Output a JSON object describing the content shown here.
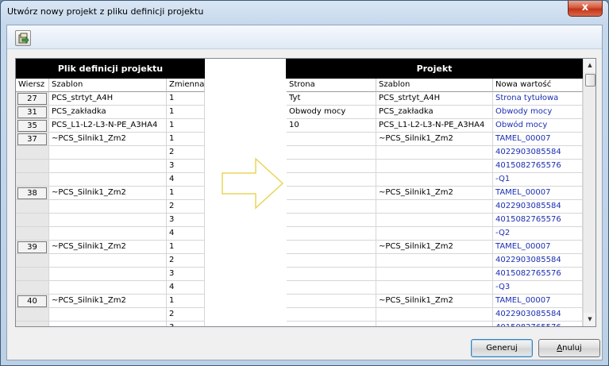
{
  "window": {
    "title": "Utwórz nowy projekt z pliku definicji projektu",
    "close_glyph": "x"
  },
  "toolbar": {
    "tool_icon": "export-icon"
  },
  "left_panel": {
    "title": "Plik definicji projektu",
    "columns": [
      "Wiersz",
      "Szablon",
      "Zmienna"
    ]
  },
  "right_panel": {
    "title": "Projekt",
    "columns": [
      "Strona",
      "Szablon",
      "Nowa wartość"
    ]
  },
  "rows": [
    {
      "wiersz": "27",
      "szablon": "PCS_strtyt_A4H",
      "zmienna": "1",
      "strona": "Tyt",
      "szablon2": "PCS_strtyt_A4H",
      "nowa": "Strona tytułowa"
    },
    {
      "wiersz": "31",
      "szablon": "PCS_zakładka",
      "zmienna": "1",
      "strona": "Obwody mocy",
      "szablon2": "PCS_zakładka",
      "nowa": "Obwody mocy"
    },
    {
      "wiersz": "35",
      "szablon": "PCS_L1-L2-L3-N-PE_A3HA4",
      "zmienna": "1",
      "strona": "10",
      "szablon2": "PCS_L1-L2-L3-N-PE_A3HA4",
      "nowa": "Obwód mocy"
    },
    {
      "wiersz": "37",
      "szablon": "~PCS_Silnik1_Zm2",
      "zmienna": "1",
      "strona": "",
      "szablon2": "~PCS_Silnik1_Zm2",
      "nowa": "TAMEL_00007"
    },
    {
      "wiersz": "",
      "szablon": "",
      "zmienna": "2",
      "strona": "",
      "szablon2": "",
      "nowa": "4022903085584"
    },
    {
      "wiersz": "",
      "szablon": "",
      "zmienna": "3",
      "strona": "",
      "szablon2": "",
      "nowa": "4015082765576"
    },
    {
      "wiersz": "",
      "szablon": "",
      "zmienna": "4",
      "strona": "",
      "szablon2": "",
      "nowa": "-Q1"
    },
    {
      "wiersz": "38",
      "szablon": "~PCS_Silnik1_Zm2",
      "zmienna": "1",
      "strona": "",
      "szablon2": "~PCS_Silnik1_Zm2",
      "nowa": "TAMEL_00007"
    },
    {
      "wiersz": "",
      "szablon": "",
      "zmienna": "2",
      "strona": "",
      "szablon2": "",
      "nowa": "4022903085584"
    },
    {
      "wiersz": "",
      "szablon": "",
      "zmienna": "3",
      "strona": "",
      "szablon2": "",
      "nowa": "4015082765576"
    },
    {
      "wiersz": "",
      "szablon": "",
      "zmienna": "4",
      "strona": "",
      "szablon2": "",
      "nowa": "-Q2"
    },
    {
      "wiersz": "39",
      "szablon": "~PCS_Silnik1_Zm2",
      "zmienna": "1",
      "strona": "",
      "szablon2": "~PCS_Silnik1_Zm2",
      "nowa": "TAMEL_00007"
    },
    {
      "wiersz": "",
      "szablon": "",
      "zmienna": "2",
      "strona": "",
      "szablon2": "",
      "nowa": "4022903085584"
    },
    {
      "wiersz": "",
      "szablon": "",
      "zmienna": "3",
      "strona": "",
      "szablon2": "",
      "nowa": "4015082765576"
    },
    {
      "wiersz": "",
      "szablon": "",
      "zmienna": "4",
      "strona": "",
      "szablon2": "",
      "nowa": "-Q3"
    },
    {
      "wiersz": "40",
      "szablon": "~PCS_Silnik1_Zm2",
      "zmienna": "1",
      "strona": "",
      "szablon2": "~PCS_Silnik1_Zm2",
      "nowa": "TAMEL_00007"
    },
    {
      "wiersz": "",
      "szablon": "",
      "zmienna": "2",
      "strona": "",
      "szablon2": "",
      "nowa": "4022903085584"
    },
    {
      "wiersz": "",
      "szablon": "",
      "zmienna": "3",
      "strona": "",
      "szablon2": "",
      "nowa": "4015082765576"
    }
  ],
  "scrollbar": {
    "up_glyph": "▲",
    "down_glyph": "▼"
  },
  "buttons": {
    "generate": "Generuj",
    "cancel_underlined": "A",
    "cancel_rest": "nuluj"
  },
  "colors": {
    "value_text": "#1b2fb0",
    "header_bg": "#000000",
    "arrow": "#e8d65a"
  }
}
